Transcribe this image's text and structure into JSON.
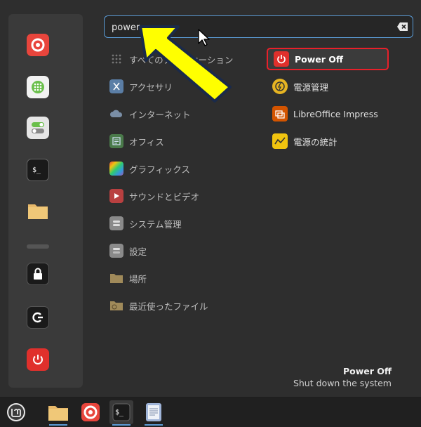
{
  "search": {
    "value": "power"
  },
  "categories": [
    {
      "label": "すべてのアプリケーション",
      "icon": "grid-icon",
      "color": "#6a6a6a"
    },
    {
      "label": "アクセサリ",
      "icon": "scissors-icon",
      "color": "#5b7ea6"
    },
    {
      "label": "インターネット",
      "icon": "cloud-icon",
      "color": "#7a8ea6"
    },
    {
      "label": "オフィス",
      "icon": "office-icon",
      "color": "#4a7a4a"
    },
    {
      "label": "グラフィックス",
      "icon": "graphics-icon",
      "color": "#9b59b6"
    },
    {
      "label": "サウンドとビデオ",
      "icon": "play-icon",
      "color": "#b94040"
    },
    {
      "label": "システム管理",
      "icon": "system-icon",
      "color": "#8a8a8a"
    },
    {
      "label": "設定",
      "icon": "settings-icon",
      "color": "#8a8a8a"
    },
    {
      "label": "場所",
      "icon": "folder-icon",
      "color": "#a08a5a"
    },
    {
      "label": "最近使ったファイル",
      "icon": "recent-folder-icon",
      "color": "#a08a5a"
    }
  ],
  "results": [
    {
      "label": "Power Off",
      "icon": "power-icon",
      "color": "#e0302c",
      "selected": true
    },
    {
      "label": "電源管理",
      "icon": "power-manager-icon",
      "color": "#e6b422"
    },
    {
      "label": "LibreOffice Impress",
      "icon": "impress-icon",
      "color": "#d35400"
    },
    {
      "label": "電源の統計",
      "icon": "power-statistics-icon",
      "color": "#f1c40f"
    }
  ],
  "description": {
    "title": "Power Off",
    "subtitle": "Shut down the system"
  },
  "colors": {
    "accent": "#5b9bd5",
    "highlight_border": "#e8202a",
    "arrow": "#ffff00"
  }
}
